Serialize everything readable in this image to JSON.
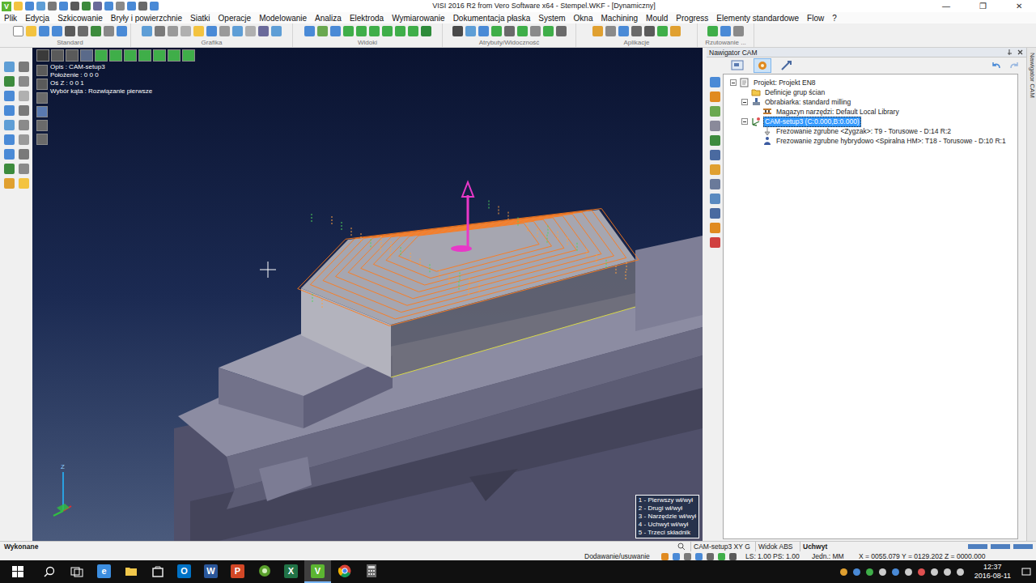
{
  "window": {
    "app_glyph": "V",
    "title": "VISI 2016 R2 from Vero Software x64 - Stempel.WKF - [Dynamiczny]",
    "controls": [
      "—",
      "❐",
      "✕"
    ]
  },
  "menu": [
    "Plik",
    "Edycja",
    "Szkicowanie",
    "Bryły i powierzchnie",
    "Siatki",
    "Operacje",
    "Modelowanie",
    "Analiza",
    "Elektroda",
    "Wymiarowanie",
    "Dokumentacja płaska",
    "System",
    "Okna",
    "Machining",
    "Mould",
    "Progress",
    "Elementy standardowe",
    "Flow",
    "?"
  ],
  "toolbar_groups": [
    "Standard",
    "Grafika",
    "Widoki",
    "Atrybuty/Widoczność",
    "Aplikacje",
    "Rzutowanie ..."
  ],
  "viewport": {
    "info": [
      "Opis : CAM-setup3",
      "Położenie : 0 0 0",
      "Oś Z : 0 0 1",
      "Wybór kąta : Rozwiązanie pierwsze"
    ],
    "legend": [
      "1 - Pierwszy wł/wył",
      "2 - Drugi wł/wył",
      "3 - Narzędzie wł/wył",
      "4 - Uchwyt wł/wył",
      "5 - Trzeci składnik"
    ],
    "axis_label": "Z"
  },
  "cam_navigator": {
    "title": "Nawigator CAM",
    "side_tab": "Nawigator CAM",
    "tree": [
      {
        "label": "Projekt: Projekt EN8",
        "level": 0,
        "kind": "project",
        "expanded": true,
        "selected": false
      },
      {
        "label": "Definicje grup ścian",
        "level": 1,
        "kind": "folder",
        "selected": false
      },
      {
        "label": "Obrabiarka: standard milling",
        "level": 1,
        "kind": "machine",
        "expanded": true,
        "selected": false
      },
      {
        "label": "Magazyn narzędzi: Default Local Library",
        "level": 2,
        "kind": "library",
        "selected": false
      },
      {
        "label": "CAM-setup3 (C:0.000,B:0.000)",
        "level": 1,
        "kind": "setup",
        "expanded": true,
        "selected": true
      },
      {
        "label": "Frezowanie zgrubne <Zygzak>: T9 - Torusowe - D:14 R:2",
        "level": 2,
        "kind": "operation",
        "selected": false
      },
      {
        "label": "Frezowanie zgrubne hybrydowo <Spiralna HM>: T18 - Torusowe - D:10 R:1",
        "level": 2,
        "kind": "operation-hybrid",
        "selected": false
      }
    ]
  },
  "status_bar": {
    "message": "Wykonane",
    "setup": "CAM-setup3 XY G",
    "view": "Widok ABS",
    "mode": "Uchwyt",
    "action": "Dodawanie/usuwanie",
    "scale": "LS: 1.00 PS: 1.00",
    "units": "Jedn.: MM",
    "coords": "X = 0055.079 Y = 0129.202 Z = 0000.000"
  },
  "taskbar": {
    "apps": [
      {
        "name": "edge",
        "kind": "letter",
        "glyph": "e",
        "color": "#3c8ee0",
        "active": false
      },
      {
        "name": "explorer",
        "kind": "folder",
        "color": "#f2c84b",
        "active": false
      },
      {
        "name": "store",
        "kind": "bag",
        "color": "#e8e8e8",
        "active": false
      },
      {
        "name": "outlook",
        "kind": "letter",
        "glyph": "O",
        "color": "#0072c6",
        "active": false
      },
      {
        "name": "word",
        "kind": "letter",
        "glyph": "W",
        "color": "#2b579a",
        "active": false
      },
      {
        "name": "powerpoint",
        "kind": "letter",
        "glyph": "P",
        "color": "#d24726",
        "active": false
      },
      {
        "name": "green-app",
        "kind": "circle",
        "color": "#5aa02c",
        "active": false
      },
      {
        "name": "excel",
        "kind": "letter",
        "glyph": "X",
        "color": "#217346",
        "active": false
      },
      {
        "name": "visi",
        "kind": "letter",
        "glyph": "V",
        "color": "#5cb531",
        "active": true
      },
      {
        "name": "chrome",
        "kind": "chrome",
        "color": "#db4437",
        "active": false
      },
      {
        "name": "calculator",
        "kind": "calc",
        "color": "#6b6b6b",
        "active": false
      }
    ],
    "time": "12:37",
    "date": "2016-08-11"
  }
}
